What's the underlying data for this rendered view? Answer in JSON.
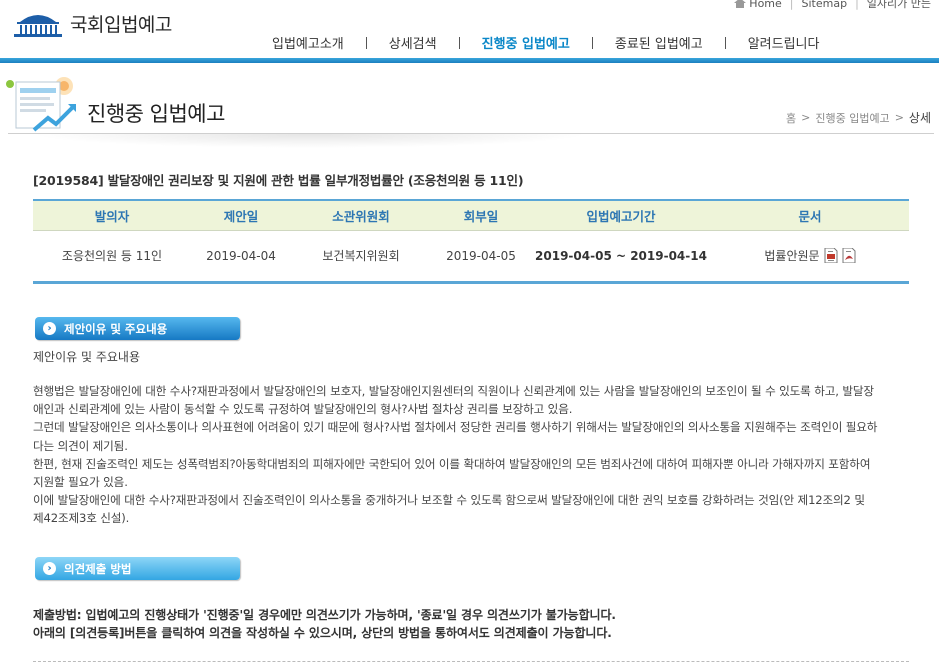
{
  "header": {
    "logo_text": "국회입법예고",
    "util_links": [
      "Home",
      "Sitemap",
      "일자리가 만든"
    ],
    "nav": [
      "입법예고소개",
      "상세검색",
      "진행중 입법예고",
      "종료된 입법예고",
      "알려드립니다"
    ],
    "active_nav": "진행중 입법예고"
  },
  "page": {
    "title": "진행중 입법예고",
    "breadcrumb": [
      "홈",
      "진행중 입법예고",
      "상세"
    ]
  },
  "bill": {
    "title": "[2019584] 발달장애인 권리보장 및 지원에 관한 법률 일부개정법률안 (조응천의원 등 11인)"
  },
  "table": {
    "headers": [
      "발의자",
      "제안일",
      "소관위원회",
      "회부일",
      "입법예고기간",
      "문서"
    ],
    "row": {
      "proposer": "조응천의원 등 11인",
      "proposed_date": "2019-04-04",
      "committee": "보건복지위원회",
      "referral_date": "2019-04-05",
      "period": "2019-04-05 ~ 2019-04-14",
      "document": "법률안원문",
      "doc_icons": [
        "hwp-file-icon",
        "pdf-file-icon"
      ]
    }
  },
  "section1": {
    "button": "제안이유 및 주요내용",
    "subtitle": "제안이유 및 주요내용",
    "paragraphs": [
      "현행법은 발달장애인에 대한 수사?재판과정에서 발달장애인의 보호자, 발달장애인지원센터의 직원이나 신뢰관계에 있는 사람을 발달장애인의 보조인이 될 수 있도록 하고, 발달장애인과 신뢰관계에 있는 사람이 동석할 수 있도록 규정하여 발달장애인의 형사?사법 절차상 권리를 보장하고 있음.",
      "그런데 발달장애인은 의사소통이나 의사표현에 어려움이 있기 때문에 형사?사법 절차에서 정당한 권리를 행사하기 위해서는 발달장애인의 의사소통을 지원해주는 조력인이 필요하다는 의견이 제기됨.",
      "한편, 현재 진술조력인 제도는 성폭력범죄?아동학대범죄의 피해자에만 국한되어 있어 이를 확대하여 발달장애인의 모든 범죄사건에 대하여 피해자뿐 아니라 가해자까지 포함하여 지원할 필요가 있음.",
      "이에 발달장애인에 대한 수사?재판과정에서 진술조력인이 의사소통을 중개하거나 보조할 수 있도록 함으로써 발달장애인에 대한 권익 보호를 강화하려는 것임(안 제12조의2 및 제42조제3호 신설)."
    ]
  },
  "section2": {
    "button": "의견제출 방법",
    "lines": [
      "제출방법: 입법예고의 진행상태가 '진행중'일 경우에만 의견쓰기가 가능하며, '종료'일 경우 의견쓰기가 불가능합니다.",
      "아래의 [의견등록]버튼을 클릭하여 의견을 작성하실 수 있으시며, 상단의 방법을 통하여서도 의견제출이 가능합니다."
    ]
  },
  "colors": {
    "accent": "#1b7fbf",
    "nav_active": "#0a87c8",
    "table_header_bg": "#eef4d9",
    "table_header_text": "#2d76b3"
  }
}
